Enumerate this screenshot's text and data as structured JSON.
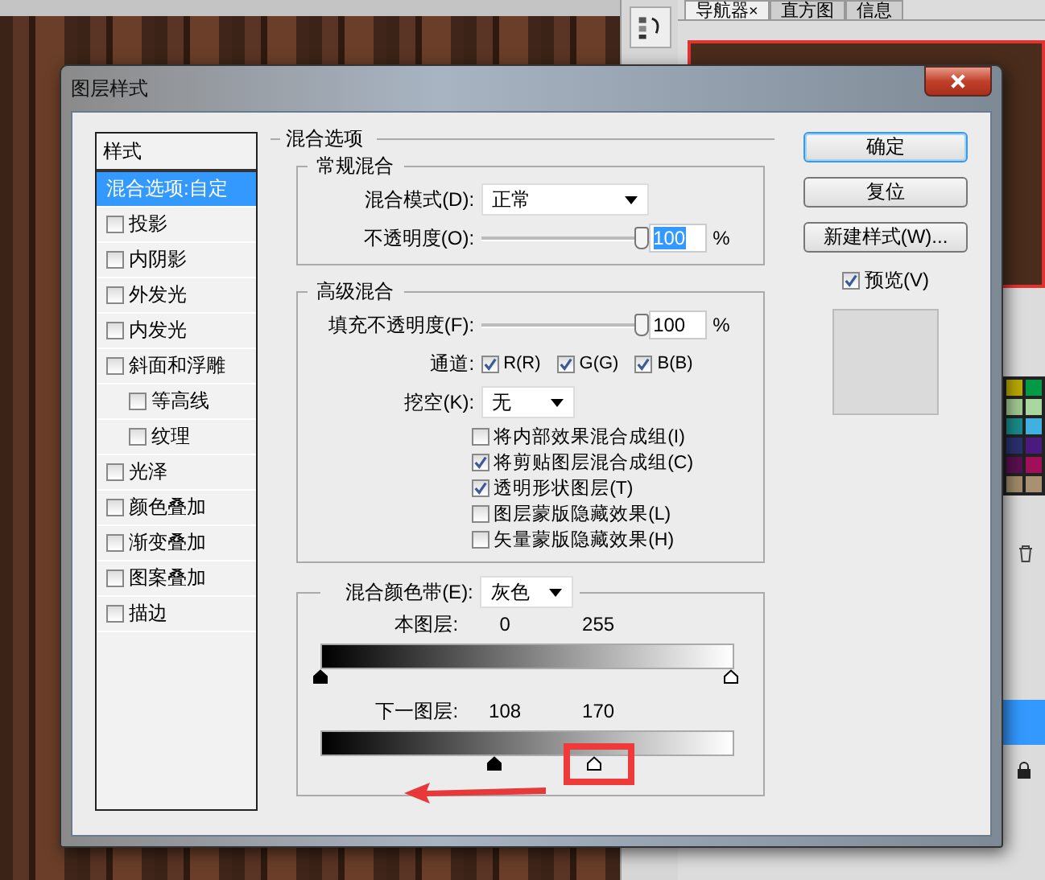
{
  "workspace": {
    "tabs": [
      {
        "label": "导航器",
        "selected": true,
        "close": "×"
      },
      {
        "label": "直方图",
        "selected": false
      },
      {
        "label": "信息",
        "selected": false
      }
    ],
    "swatches": [
      {
        "color": "#b8a800"
      },
      {
        "color": "#009a44"
      },
      {
        "color": "#a0c890"
      },
      {
        "color": "#a8d8a0"
      },
      {
        "color": "#1a8a8a"
      },
      {
        "color": "#40b0e0"
      },
      {
        "color": "#2a3070"
      },
      {
        "color": "#4a1a80"
      },
      {
        "color": "#5a1050"
      },
      {
        "color": "#a0105a"
      },
      {
        "color": "#a08a6a"
      },
      {
        "color": "#a89070"
      }
    ]
  },
  "dialog": {
    "title": "图层样式",
    "styles": {
      "header": "样式",
      "items": [
        {
          "label": "混合选项:自定",
          "kind": "options",
          "selected": true
        },
        {
          "label": "投影",
          "kind": "effect",
          "checked": false,
          "selected": false
        },
        {
          "label": "内阴影",
          "kind": "effect",
          "checked": false,
          "selected": false
        },
        {
          "label": "外发光",
          "kind": "effect",
          "checked": false,
          "selected": false
        },
        {
          "label": "内发光",
          "kind": "effect",
          "checked": false,
          "selected": false
        },
        {
          "label": "斜面和浮雕",
          "kind": "effect",
          "checked": false,
          "selected": false,
          "children": [
            {
              "label": "等高线",
              "kind": "effect",
              "checked": false,
              "selected": false
            },
            {
              "label": "纹理",
              "kind": "effect",
              "checked": false,
              "selected": false
            }
          ]
        },
        {
          "label": "光泽",
          "kind": "effect",
          "checked": false,
          "selected": false
        },
        {
          "label": "颜色叠加",
          "kind": "effect",
          "checked": false,
          "selected": false
        },
        {
          "label": "渐变叠加",
          "kind": "effect",
          "checked": false,
          "selected": false
        },
        {
          "label": "图案叠加",
          "kind": "effect",
          "checked": false,
          "selected": false
        },
        {
          "label": "描边",
          "kind": "effect",
          "checked": false,
          "selected": false
        }
      ]
    },
    "blending": {
      "title": "混合选项",
      "general": {
        "title": "常规混合",
        "blend_mode": {
          "label": "混合模式(D):",
          "value": "正常"
        },
        "opacity": {
          "label": "不透明度(O):",
          "level": 1,
          "value": "100",
          "unit": "%",
          "text_selected": true
        }
      },
      "advanced": {
        "title": "高级混合",
        "fill_opacity": {
          "label": "填充不透明度(F):",
          "level": 1,
          "value": "100",
          "unit": "%",
          "text_selected": false
        },
        "channels": {
          "label": "通道:",
          "items": [
            {
              "label": "R(R)",
              "checked": true
            },
            {
              "label": "G(G)",
              "checked": true
            },
            {
              "label": "B(B)",
              "checked": true
            }
          ]
        },
        "knockout": {
          "label": "挖空(K):",
          "value": "无"
        },
        "options": [
          {
            "label": "将内部效果混合成组(I)",
            "checked": false
          },
          {
            "label": "将剪贴图层混合成组(C)",
            "checked": true
          },
          {
            "label": "透明形状图层(T)",
            "checked": true
          },
          {
            "label": "图层蒙版隐藏效果(L)",
            "checked": false
          },
          {
            "label": "矢量蒙版隐藏效果(H)",
            "checked": false
          }
        ]
      },
      "blend_if": {
        "label": "混合颜色带(E):",
        "value": "灰色",
        "bands": [
          {
            "label": "本图层:",
            "values": [
              "0",
              "255"
            ],
            "thumbs": [
              {
                "kind": "black",
                "level": 0
              },
              {
                "kind": "white",
                "level": 1
              }
            ]
          },
          {
            "label": "下一图层:",
            "values": [
              "108",
              "170"
            ],
            "thumbs": [
              {
                "kind": "black",
                "level": 0.4235
              },
              {
                "kind": "white",
                "level": 0.6667
              }
            ]
          }
        ]
      }
    },
    "buttons": [
      {
        "label": "确定",
        "default": true
      },
      {
        "label": "复位",
        "default": false
      },
      {
        "label": "新建样式(W)...",
        "default": false
      }
    ],
    "preview": {
      "label": "预览(V)",
      "checked": true
    }
  }
}
